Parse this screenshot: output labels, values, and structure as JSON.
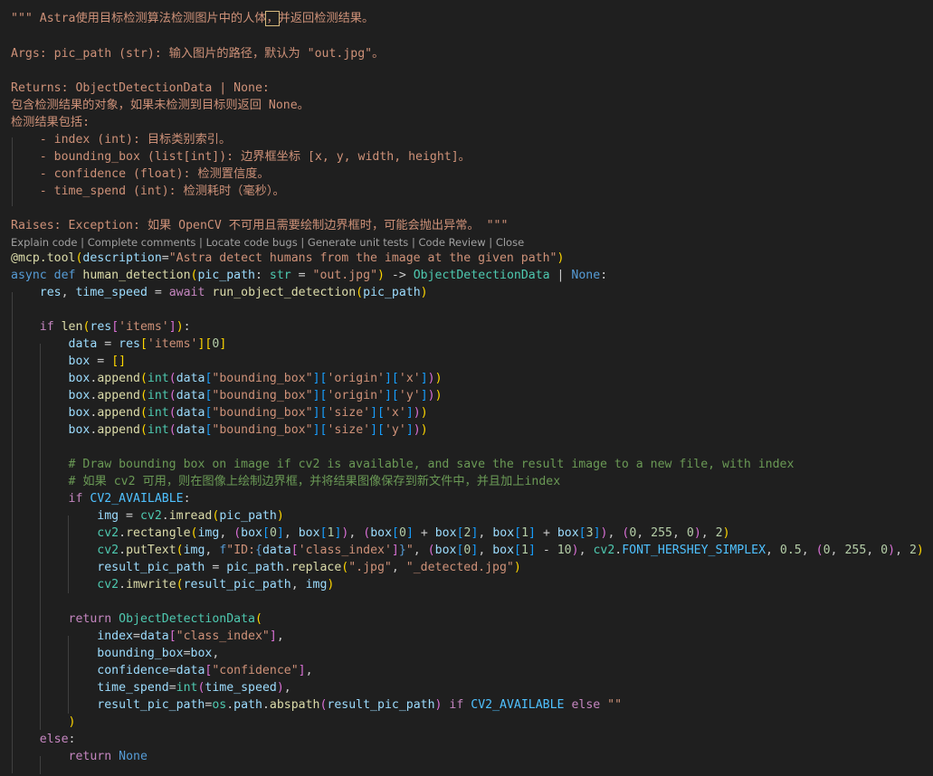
{
  "codelens": {
    "explain": "Explain code",
    "complete": "Complete comments",
    "locate": "Locate code bugs",
    "generate": "Generate unit tests",
    "review": "Code Review",
    "close": "Close",
    "separator": " | "
  },
  "code": {
    "doc_open": "\"\"\" Astra使用目标检测算法检测图片中的人体",
    "doc_comma": "，",
    "doc_tail": "并返回检测结果。",
    "args": "Args: pic_path (str): 输入图片的路径，默认为 \"out.jpg\"。",
    "returns": "Returns: ObjectDetectionData | None:",
    "returns_desc": "包含检测结果的对象，如果未检测到目标则返回 None。",
    "includes": "检测结果包括:",
    "item_index": "    - index (int): 目标类别索引。",
    "item_bbox": "    - bounding_box (list[int]): 边界框坐标 [x, y, width, height]。",
    "item_conf": "    - confidence (float): 检测置信度。",
    "item_time": "    - time_spend (int): 检测耗时（毫秒）。",
    "raises": "Raises: Exception: 如果 OpenCV 不可用且需要绘制边界框时，可能会抛出异常。 \"\"\"",
    "comment_en": "# Draw bounding box on image if cv2 is available, and save the result image to a new file, with index",
    "comment_cn": "# 如果 cv2 可用，则在图像上绘制边界框，并将结果图像保存到新文件中，并且加上index"
  }
}
